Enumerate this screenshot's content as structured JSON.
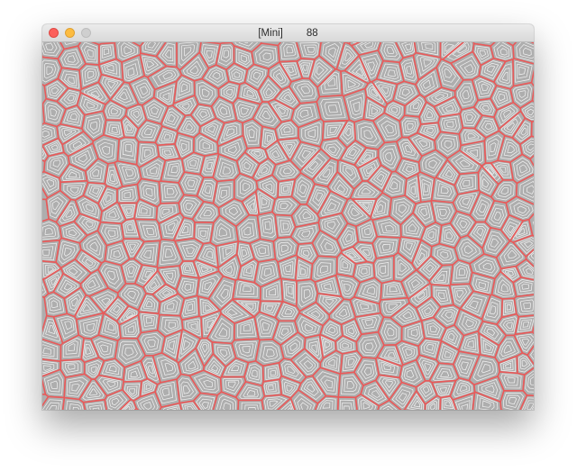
{
  "window": {
    "title": "[Mini]",
    "fps": "88"
  },
  "traffic_lights": {
    "close_icon": "close-icon",
    "minimize_icon": "minimize-icon",
    "zoom_icon": "zoom-icon"
  },
  "canvas": {
    "background_color": "#aeaeae",
    "cell_edge_color": "#e85a5a",
    "contour_color": "#ffffff",
    "contour_levels": 3
  }
}
